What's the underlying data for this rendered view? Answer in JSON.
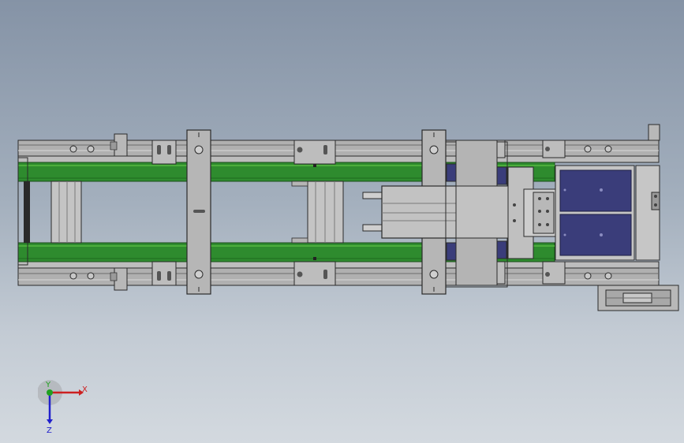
{
  "viewport": {
    "background_top": "#8593a6",
    "background_bottom": "#d3d9df"
  },
  "colors": {
    "frame_gray": "#a9a9a9",
    "frame_light": "#c0c0c0",
    "belt_green": "#2e8b2e",
    "belt_green_light": "#4cae3c",
    "pad_blue": "#3a3d7a",
    "outline": "#2a2a2a"
  },
  "triad": {
    "x_label": "X",
    "y_label": "Y",
    "z_label": "Z",
    "x_color": "#cc2020",
    "y_color": "#20a020",
    "z_color": "#2020cc"
  }
}
